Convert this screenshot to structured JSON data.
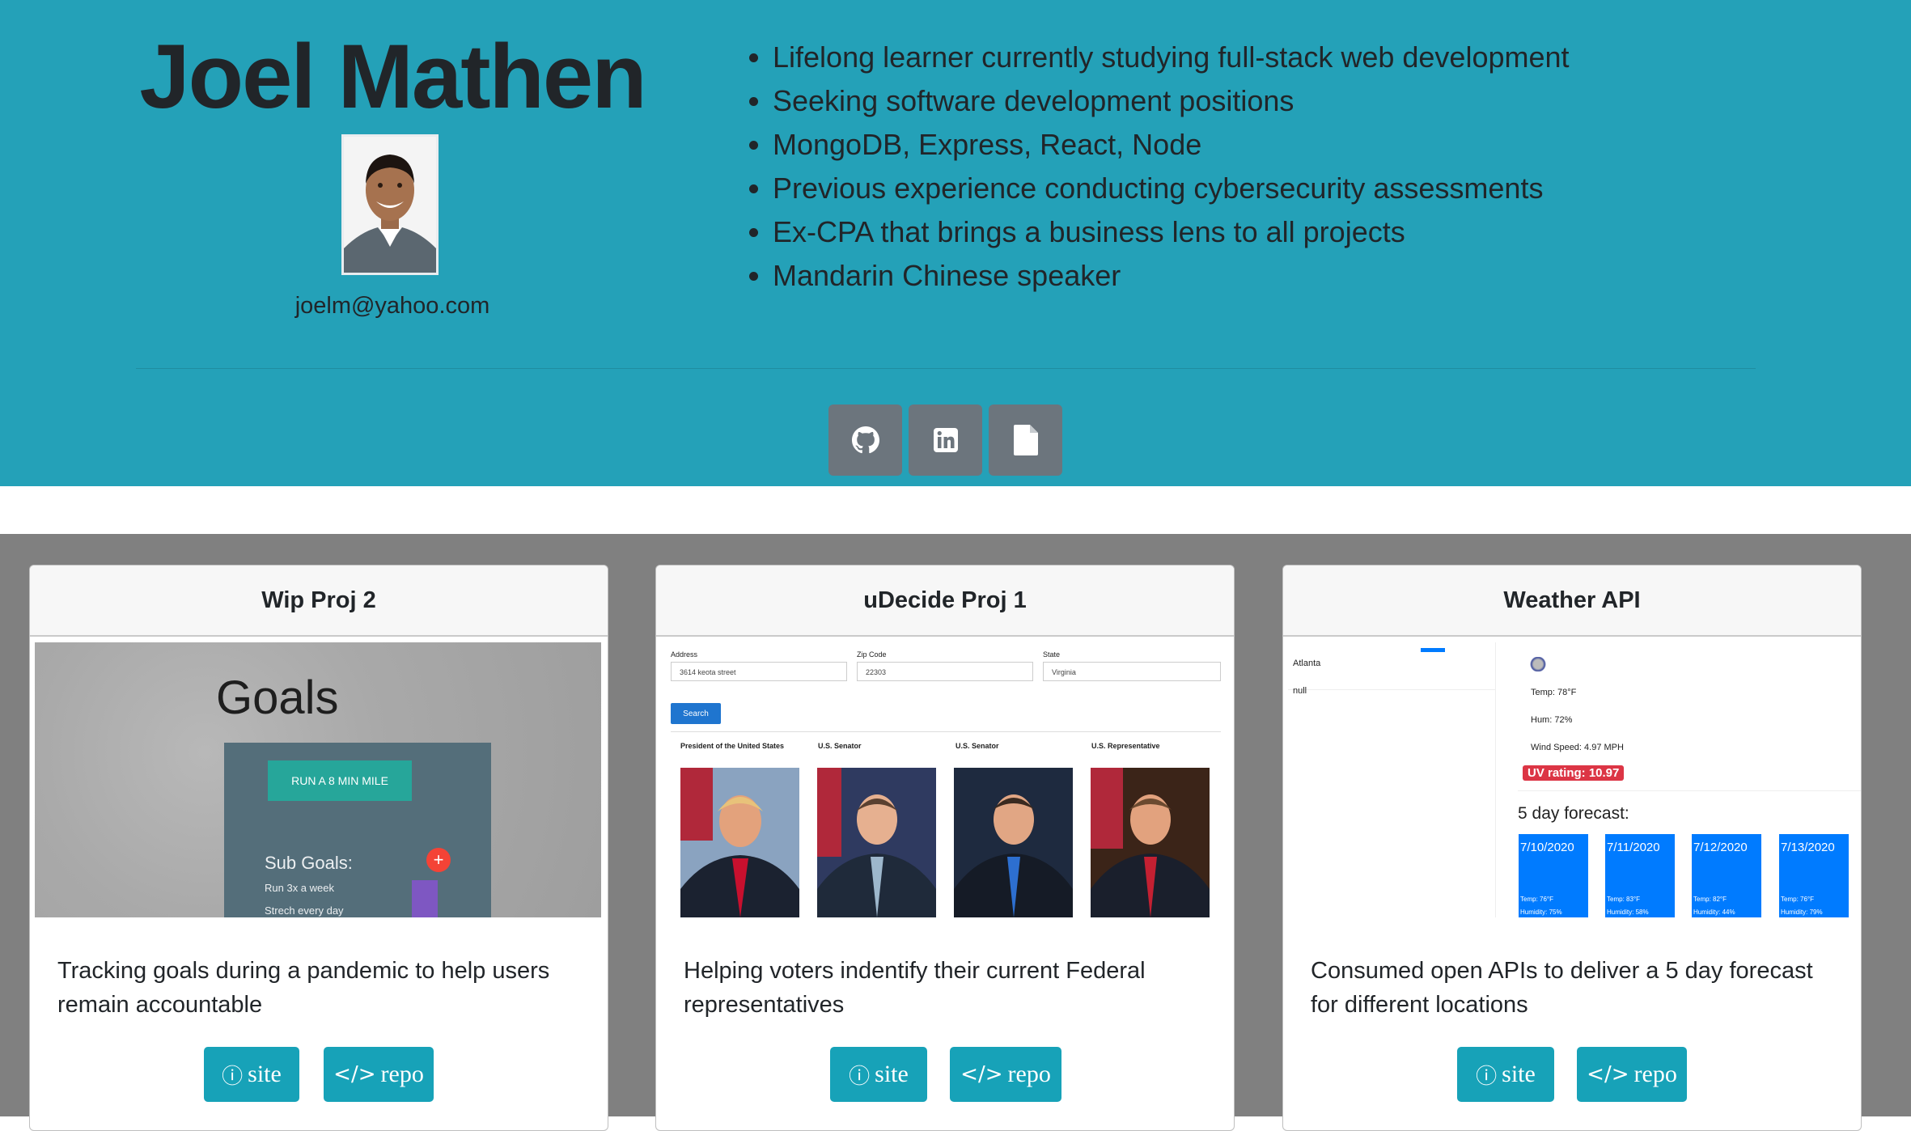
{
  "profile": {
    "name": "Joel Mathen",
    "email": "joelm@yahoo.com"
  },
  "highlights": [
    "Lifelong learner currently studying full-stack web development",
    "Seeking software development positions",
    "MongoDB, Express, React, Node",
    "Previous experience conducting cybersecurity assessments",
    "Ex-CPA that brings a business lens to all projects",
    "Mandarin Chinese speaker"
  ],
  "social_links": [
    {
      "icon": "github-icon"
    },
    {
      "icon": "linkedin-icon"
    },
    {
      "icon": "file-icon"
    }
  ],
  "colors": {
    "header_bg": "#24a1b8",
    "button_bg": "#17a2b8",
    "social_bg": "#6c757d",
    "section_bg": "#808080"
  },
  "projects": [
    {
      "title": "Wip Proj 2",
      "description": "Tracking goals during a pandemic to help users remain accountable",
      "site_label": "site",
      "repo_label": "repo",
      "screenshot": {
        "heading": "Goals",
        "goal_button": "RUN A 8 MIN MILE",
        "sub_goals_label": "Sub Goals:",
        "sub_goal_1": "Run 3x a week",
        "sub_goal_2": "Strech every day",
        "plus": "+"
      }
    },
    {
      "title": "uDecide Proj 1",
      "description": "Helping voters indentify their current Federal representatives",
      "site_label": "site",
      "repo_label": "repo",
      "screenshot": {
        "address_label": "Address",
        "address_value": "3614 keota street",
        "zip_label": "Zip Code",
        "zip_value": "22303",
        "state_label": "State",
        "state_value": "Virginia",
        "search_label": "Search",
        "roles": [
          "President of the United States",
          "U.S. Senator",
          "U.S. Senator",
          "U.S. Representative"
        ]
      }
    },
    {
      "title": "Weather API",
      "description": "Consumed open APIs to deliver a 5 day forecast for different locations",
      "site_label": "site",
      "repo_label": "repo",
      "screenshot": {
        "city_1": "Atlanta",
        "city_2": "null",
        "temp": "Temp: 78°F",
        "humidity": "Hum: 72%",
        "wind": "Wind Speed: 4.97 MPH",
        "uv": "UV rating: 10.97",
        "forecast_title": "5 day forecast:",
        "forecast": [
          {
            "date": "7/10/2020",
            "temp": "Temp: 76°F",
            "hum": "Humidity: 75%"
          },
          {
            "date": "7/11/2020",
            "temp": "Temp: 83°F",
            "hum": "Humidity: 58%"
          },
          {
            "date": "7/12/2020",
            "temp": "Temp: 82°F",
            "hum": "Humidity: 44%"
          },
          {
            "date": "7/13/2020",
            "temp": "Temp: 76°F",
            "hum": "Humidity: 79%"
          }
        ]
      }
    }
  ]
}
